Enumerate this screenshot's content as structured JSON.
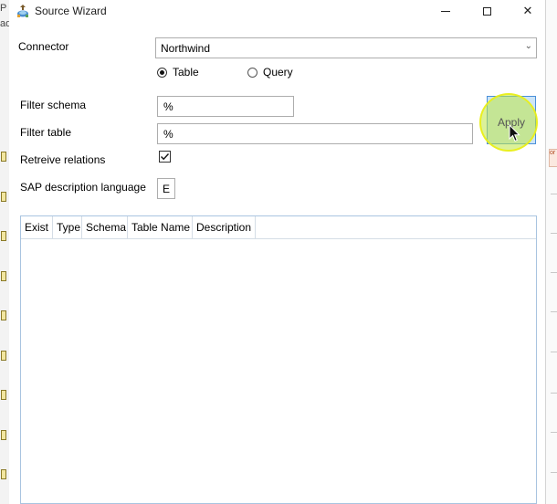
{
  "window": {
    "title": "Source Wizard",
    "minimize_label": "—",
    "close_label": "✕"
  },
  "background": {
    "left_fragments": [
      "P",
      "ad"
    ],
    "right_chip": "or"
  },
  "connector": {
    "label": "Connector",
    "value": "Northwind",
    "chevron": "⌄"
  },
  "mode": {
    "options": [
      {
        "label": "Table",
        "selected": true
      },
      {
        "label": "Query",
        "selected": false
      }
    ]
  },
  "filter_schema": {
    "label": "Filter schema",
    "value": "%"
  },
  "filter_table": {
    "label": "Filter table",
    "value": "%"
  },
  "retrieve_relations": {
    "label": "Retreive relations",
    "checked": true
  },
  "sap_language": {
    "label": "SAP description language",
    "value": "E"
  },
  "apply_button": {
    "label": "Apply"
  },
  "table": {
    "columns": [
      "Exist",
      "Type",
      "Schema",
      "Table Name",
      "Description"
    ],
    "rows": []
  },
  "colors": {
    "accent_border": "#4a90d9",
    "button_fill": "#cce4f7",
    "highlight": "#e6f01a"
  }
}
